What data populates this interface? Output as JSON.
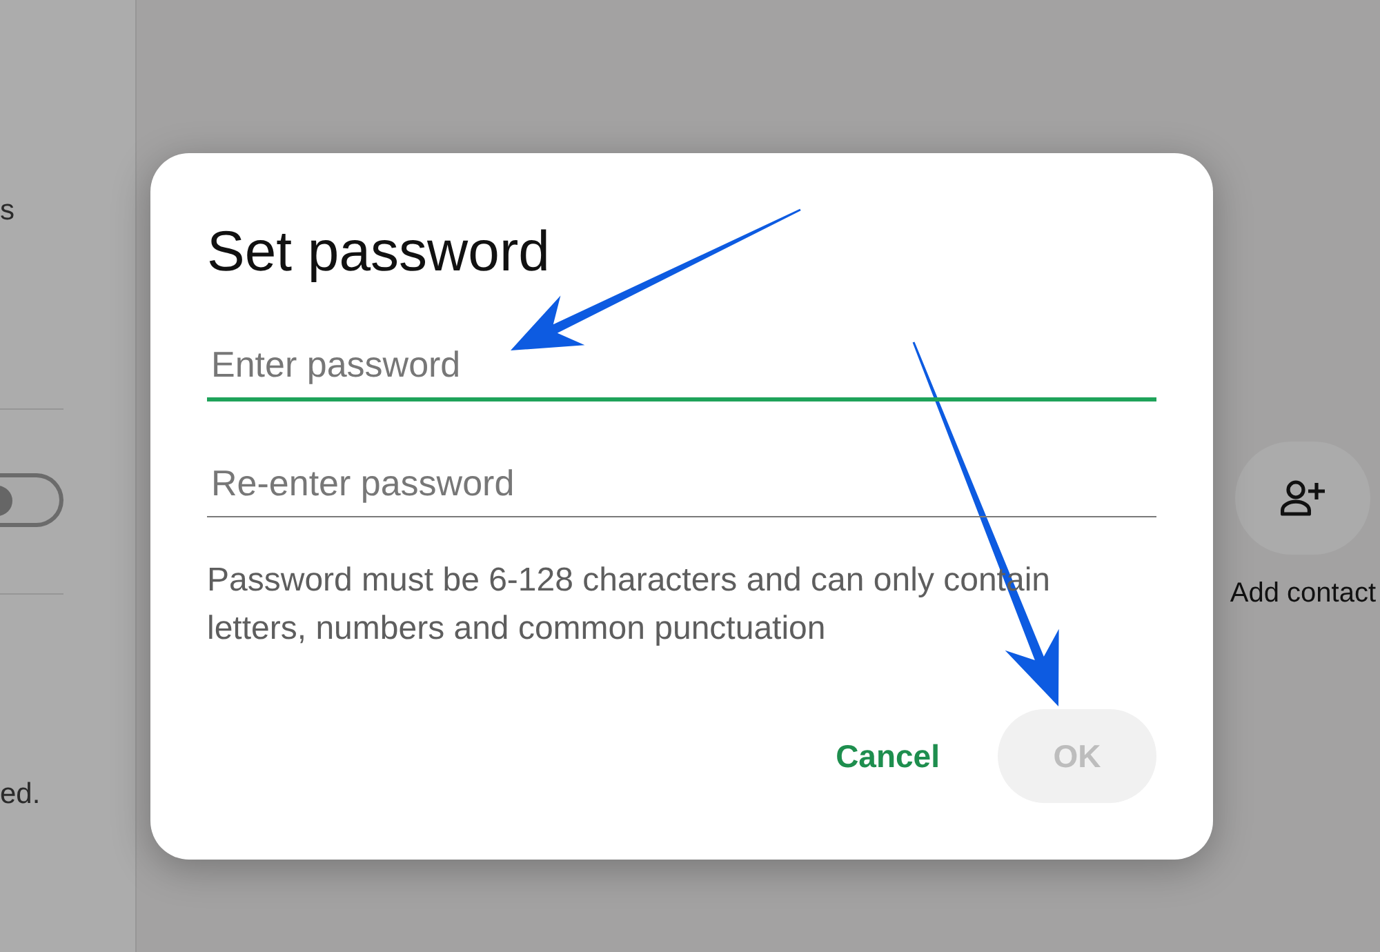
{
  "sidebar": {
    "items": [
      {
        "kind": "text",
        "text": "s"
      },
      {
        "kind": "toggle",
        "on": false
      },
      {
        "kind": "text",
        "text": "ed."
      }
    ]
  },
  "main": {
    "actions": [
      {
        "label": "Add contact"
      }
    ]
  },
  "dialog": {
    "title": "Set password",
    "fields": [
      {
        "placeholder": "Enter password",
        "focused": true
      },
      {
        "placeholder": "Re-enter password",
        "focused": false
      }
    ],
    "hint": "Password must be 6-128 characters and can only contain letters, numbers and common punctuation",
    "buttons": [
      {
        "label": "Cancel",
        "kind": "text",
        "disabled": false
      },
      {
        "label": "OK",
        "kind": "filled",
        "disabled": true
      }
    ]
  },
  "annotations": [
    {
      "kind": "arrow"
    },
    {
      "kind": "arrow"
    }
  ]
}
